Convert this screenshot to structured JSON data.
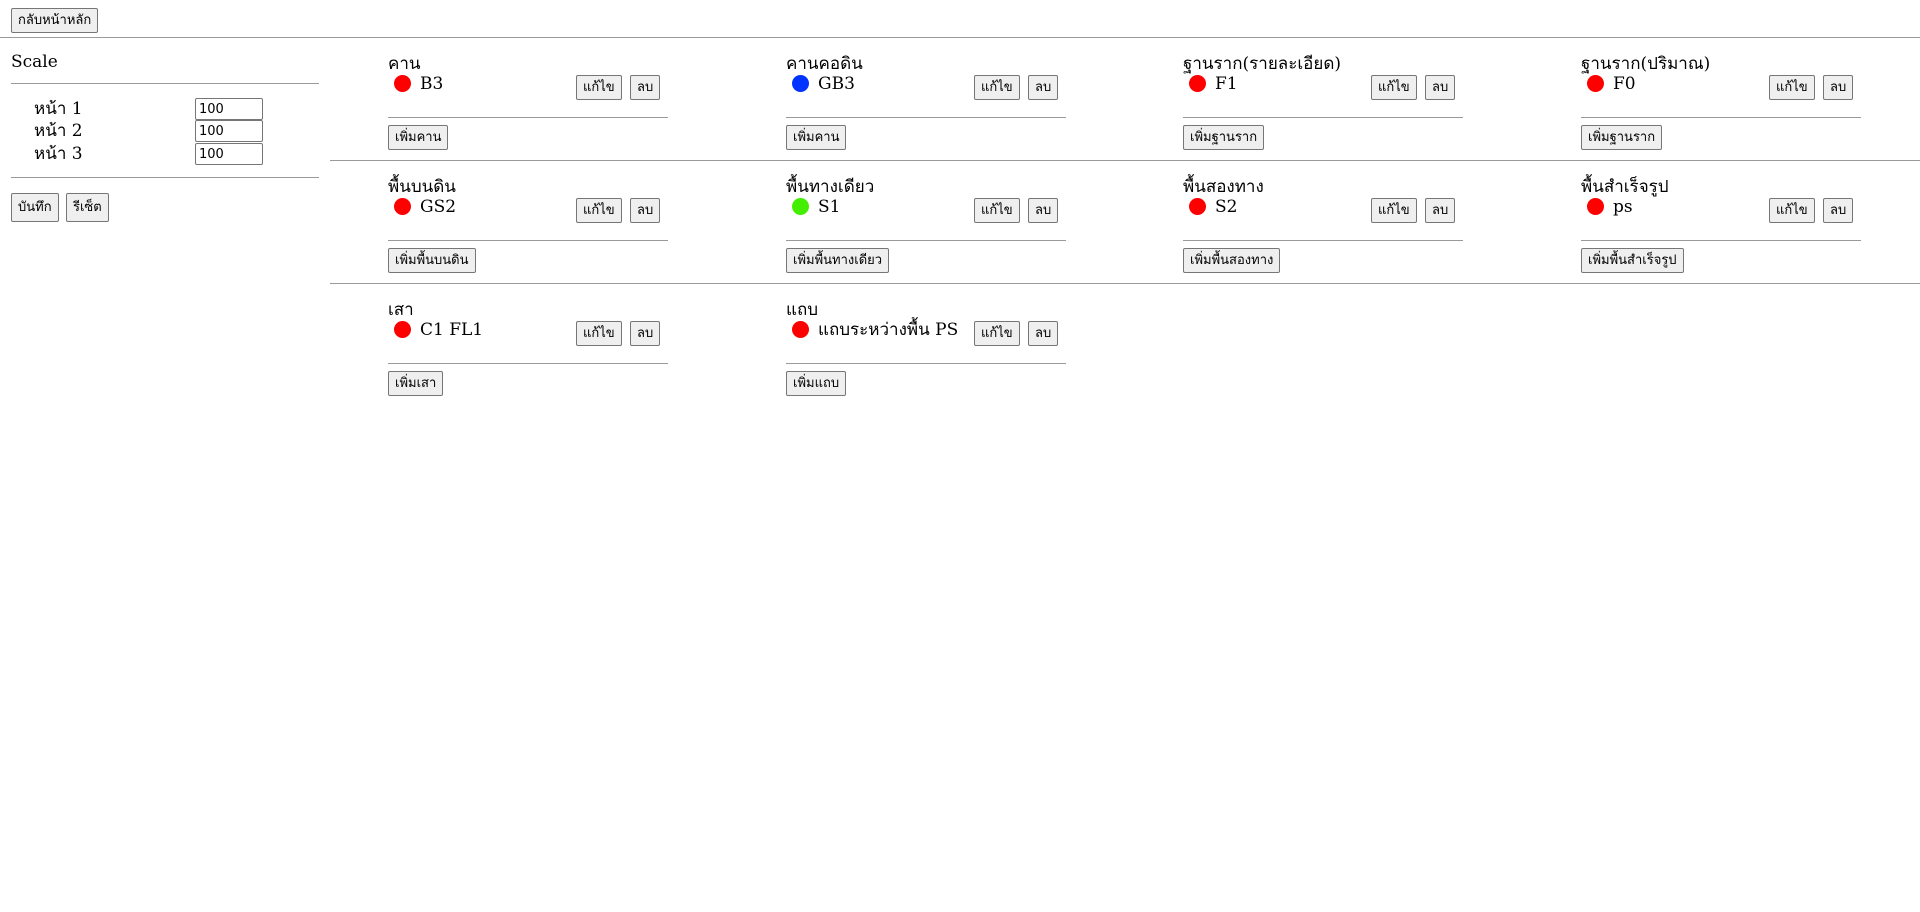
{
  "topbar": {
    "home_label": "กลับหน้าหลัก"
  },
  "scale": {
    "title": "Scale",
    "rows": [
      {
        "label": "หน้า 1",
        "value": "100"
      },
      {
        "label": "หน้า 2",
        "value": "100"
      },
      {
        "label": "หน้า 3",
        "value": "100"
      }
    ],
    "save_label": "บันทึก",
    "reset_label": "รีเซ็ต"
  },
  "colors": {
    "red": "#ff0000",
    "blue": "#0033ff",
    "green": "#44ee00"
  },
  "cards": [
    {
      "title": "คาน",
      "item": "B3",
      "dot_color": "#ff0000",
      "edit": "แก้ไข",
      "delete": "ลบ",
      "add": "เพิ่มคาน"
    },
    {
      "title": "คานคอดิน",
      "item": "GB3",
      "dot_color": "#0033ff",
      "edit": "แก้ไข",
      "delete": "ลบ",
      "add": "เพิ่มคาน"
    },
    {
      "title": "ฐานราก(รายละเอียด)",
      "item": "F1",
      "dot_color": "#ff0000",
      "edit": "แก้ไข",
      "delete": "ลบ",
      "add": "เพิ่มฐานราก"
    },
    {
      "title": "ฐานราก(ปริมาณ)",
      "item": "F0",
      "dot_color": "#ff0000",
      "edit": "แก้ไข",
      "delete": "ลบ",
      "add": "เพิ่มฐานราก"
    },
    {
      "title": "พื้นบนดิน",
      "item": "GS2",
      "dot_color": "#ff0000",
      "edit": "แก้ไข",
      "delete": "ลบ",
      "add": "เพิ่มพื้นบนดิน"
    },
    {
      "title": "พื้นทางเดียว",
      "item": "S1",
      "dot_color": "#44ee00",
      "edit": "แก้ไข",
      "delete": "ลบ",
      "add": "เพิ่มพื้นทางเดียว"
    },
    {
      "title": "พื้นสองทาง",
      "item": "S2",
      "dot_color": "#ff0000",
      "edit": "แก้ไข",
      "delete": "ลบ",
      "add": "เพิ่มพื้นสองทาง"
    },
    {
      "title": "พื้นสำเร็จรูป",
      "item": "ps",
      "dot_color": "#ff0000",
      "edit": "แก้ไข",
      "delete": "ลบ",
      "add": "เพิ่มพื้นสำเร็จรูป"
    },
    {
      "title": "เสา",
      "item": "C1 FL1",
      "dot_color": "#ff0000",
      "edit": "แก้ไข",
      "delete": "ลบ",
      "add": "เพิ่มเสา"
    },
    {
      "title": "แถบ",
      "item": "แถบระหว่างพื้น PS",
      "dot_color": "#ff0000",
      "edit": "แก้ไข",
      "delete": "ลบ",
      "add": "เพิ่มแถบ"
    }
  ]
}
